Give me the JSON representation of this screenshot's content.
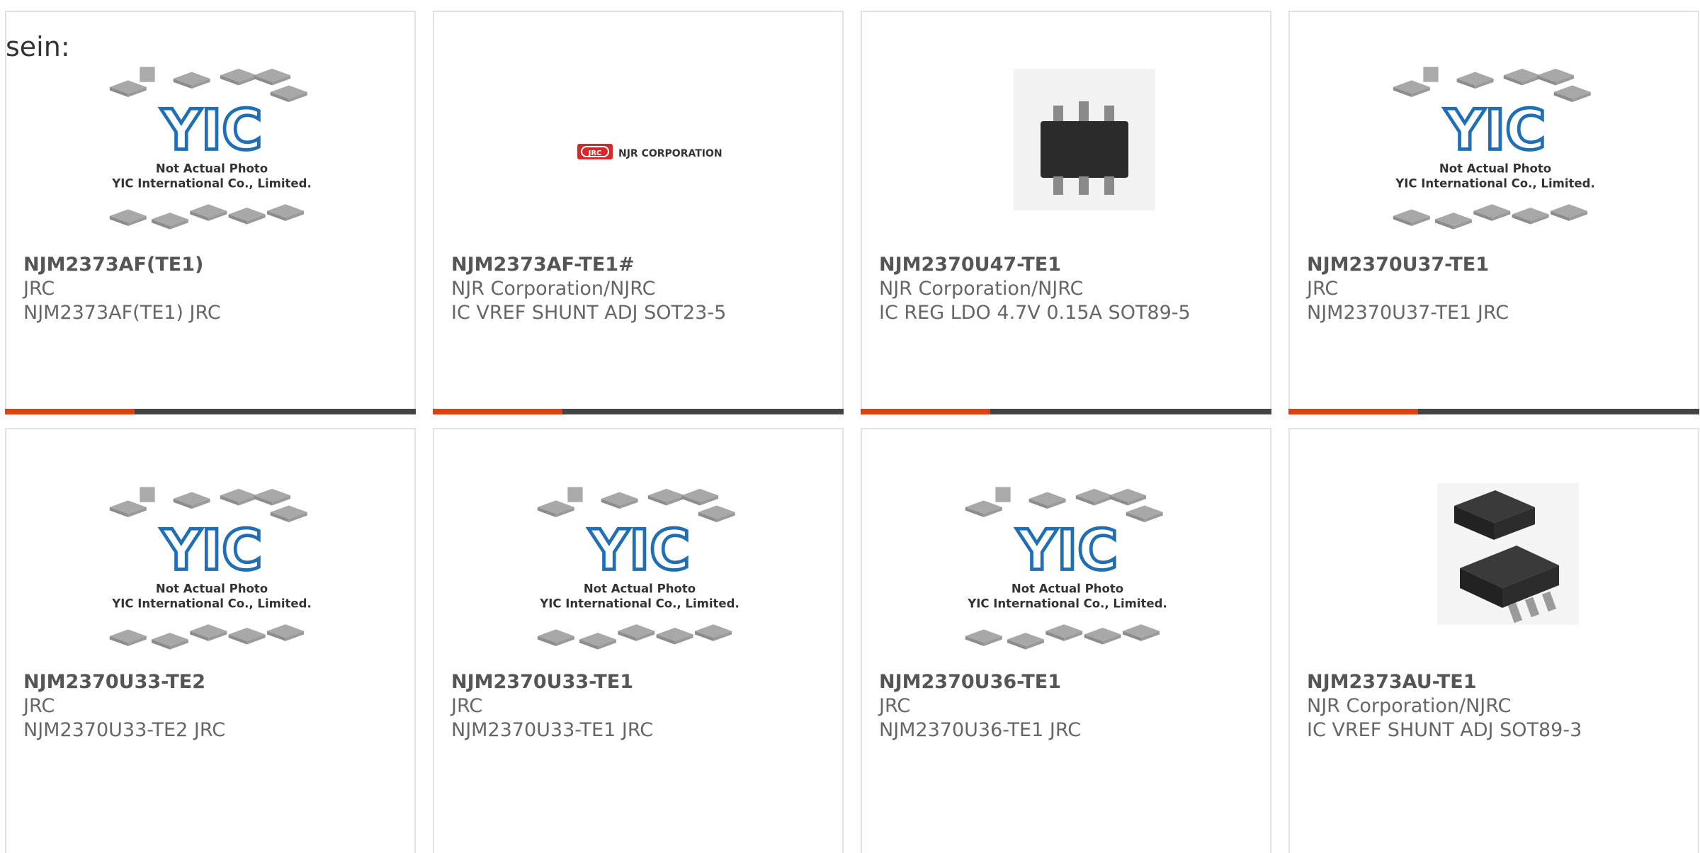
{
  "intro_text": "sein:",
  "placeholder": {
    "line1": "Not Actual Photo",
    "line2": "YIC International Co., Limited.",
    "logo": "YIC"
  },
  "njr_logo": {
    "badge": "JRC",
    "text": "NJR CORPORATION"
  },
  "colors": {
    "accent": "#e04010",
    "bar": "#444444",
    "yic_blue": "#1f6fb6",
    "njr_red": "#d42a2a",
    "text": "#666666"
  },
  "products": [
    {
      "part": "NJM2373AF(TE1)",
      "manufacturer": "JRC",
      "description": "NJM2373AF(TE1) JRC",
      "image": "placeholder"
    },
    {
      "part": "NJM2373AF-TE1#",
      "manufacturer": "NJR Corporation/NJRC",
      "description": "IC VREF SHUNT ADJ SOT23-5",
      "image": "njr-logo"
    },
    {
      "part": "NJM2370U47-TE1",
      "manufacturer": "NJR Corporation/NJRC",
      "description": "IC REG LDO 4.7V 0.15A SOT89-5",
      "image": "sot89-5-photo"
    },
    {
      "part": "NJM2370U37-TE1",
      "manufacturer": "JRC",
      "description": "NJM2370U37-TE1 JRC",
      "image": "placeholder"
    },
    {
      "part": "NJM2370U33-TE2",
      "manufacturer": "JRC",
      "description": "NJM2370U33-TE2 JRC",
      "image": "placeholder"
    },
    {
      "part": "NJM2370U33-TE1",
      "manufacturer": "JRC",
      "description": "NJM2370U33-TE1 JRC",
      "image": "placeholder"
    },
    {
      "part": "NJM2370U36-TE1",
      "manufacturer": "JRC",
      "description": "NJM2370U36-TE1 JRC",
      "image": "placeholder"
    },
    {
      "part": "NJM2373AU-TE1",
      "manufacturer": "NJR Corporation/NJRC",
      "description": "IC VREF SHUNT ADJ SOT89-3",
      "image": "sot89-3-photo"
    }
  ]
}
